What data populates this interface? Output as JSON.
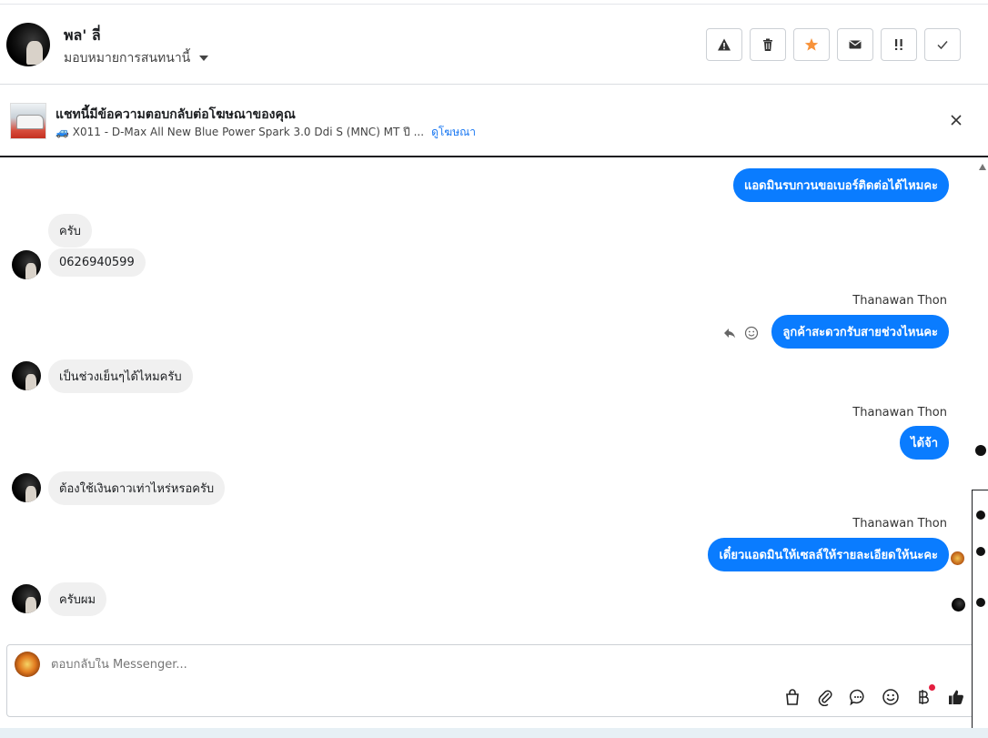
{
  "header": {
    "contact_name": "พล' ลี่",
    "assign_label": "มอบหมายการสนทนานี้",
    "actions": [
      {
        "name": "spam-button",
        "icon": "warning-icon"
      },
      {
        "name": "delete-button",
        "icon": "trash-icon"
      },
      {
        "name": "star-button",
        "icon": "star-icon"
      },
      {
        "name": "unread-button",
        "icon": "envelope-icon"
      },
      {
        "name": "follow-up-button",
        "icon": "exclamation-icon"
      },
      {
        "name": "done-button",
        "icon": "check-icon"
      }
    ]
  },
  "ad_banner": {
    "title": "แชทนี้มีข้อความตอบกลับต่อโฆษณาของคุณ",
    "ad_text": "🚙 X011 - D-Max All New Blue Power Spark 3.0 Ddi S (MNC) MT ปี ...",
    "link": "ดูโฆษณา"
  },
  "thread": {
    "messages": [
      {
        "dir": "out",
        "text": "แอดมินรบกวนขอเบอร์ติดต่อได้ไหมคะ"
      },
      {
        "dir": "in",
        "text": "ครับ"
      },
      {
        "dir": "in",
        "text": "0626940599"
      },
      {
        "dir": "out",
        "sender": "Thanawan Thon",
        "text": "ลูกค้าสะดวกรับสายช่วงไหนคะ"
      },
      {
        "dir": "in",
        "text": "เป็นช่วงเย็นๆได้ไหมครับ"
      },
      {
        "dir": "out",
        "sender": "Thanawan Thon",
        "text": "ได้จ้า"
      },
      {
        "dir": "in",
        "text": "ต้องใช้เงินดาวเท่าไหร่หรอครับ"
      },
      {
        "dir": "out",
        "sender": "Thanawan Thon",
        "text": "เดี๋ยวแอดมินให้เซลล์ให้รายละเอียดให้นะคะ"
      },
      {
        "dir": "in",
        "text": "ครับผม"
      }
    ]
  },
  "composer": {
    "placeholder": "ตอบกลับใน Messenger..."
  },
  "colors": {
    "outgoing_bubble": "#0a7cff",
    "incoming_bubble": "#f0f0f0",
    "star": "#f7923a",
    "badge": "#e41e3f"
  }
}
